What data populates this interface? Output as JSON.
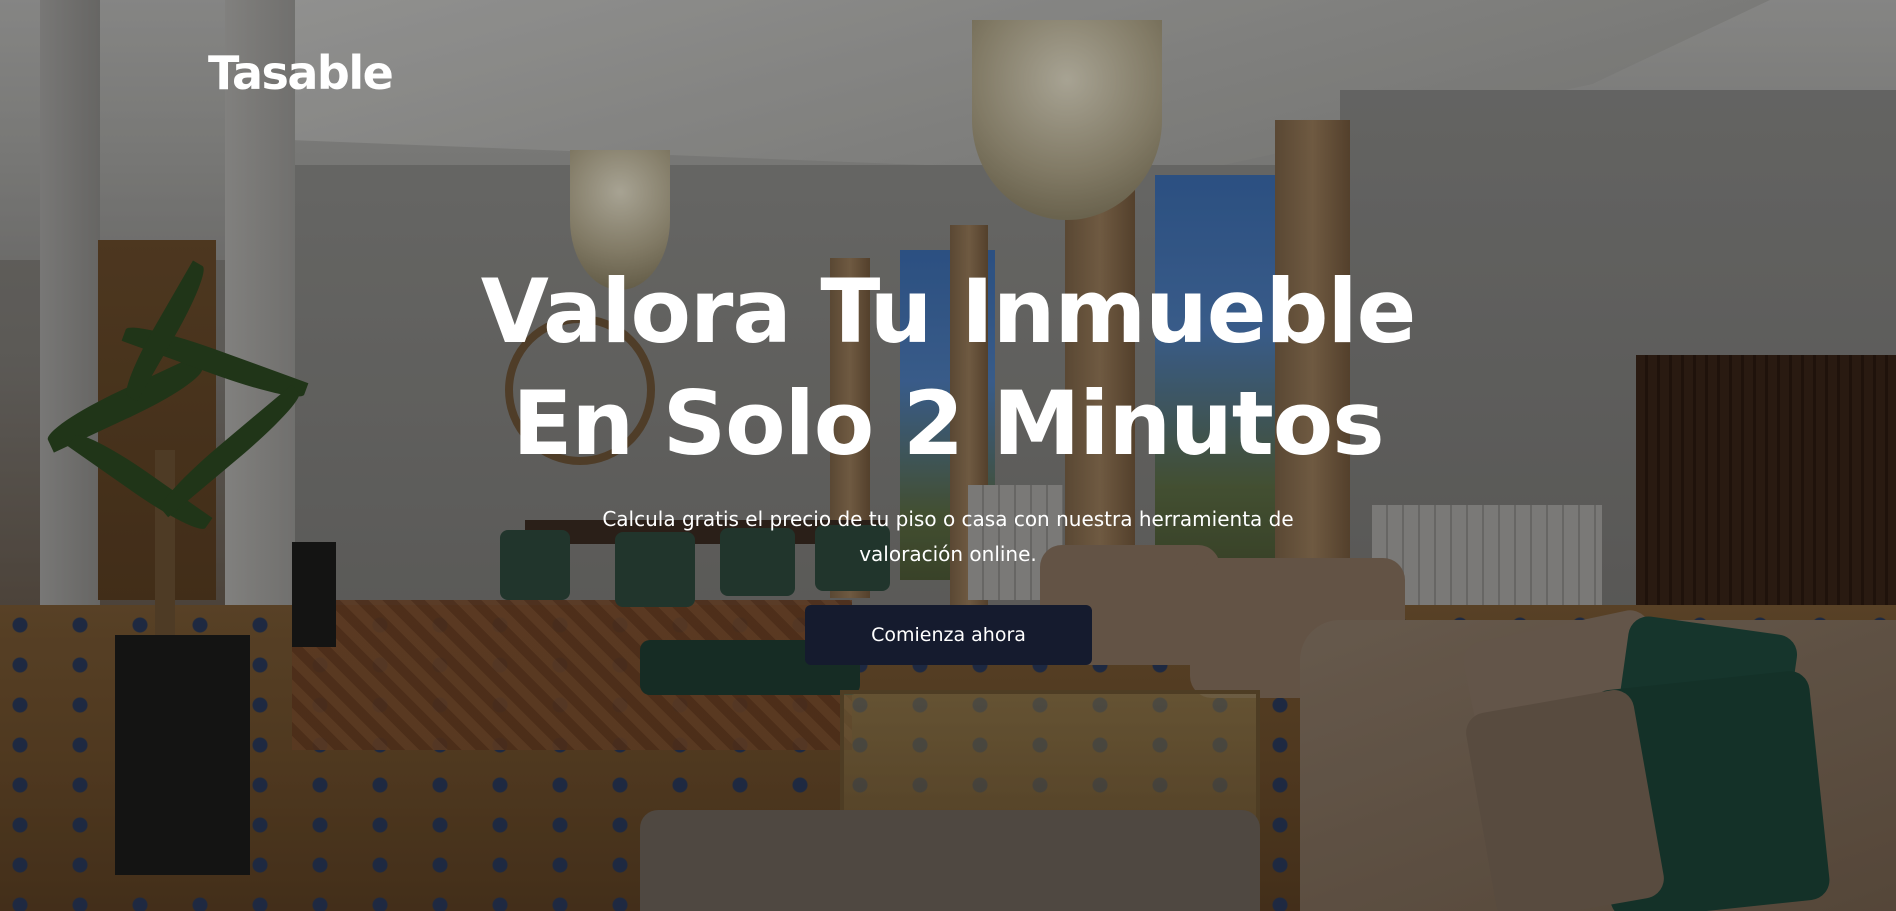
{
  "brand": {
    "logo_text": "Tasable"
  },
  "hero": {
    "headline_line1": "Valora Tu Inmueble",
    "headline_line2": "En Solo 2 Minutos",
    "subtitle": "Calcula gratis el precio de tu piso o casa con nuestra herramienta de valoración online.",
    "cta_label": "Comienza ahora"
  },
  "colors": {
    "cta_background": "#151b2e",
    "text": "#ffffff"
  }
}
